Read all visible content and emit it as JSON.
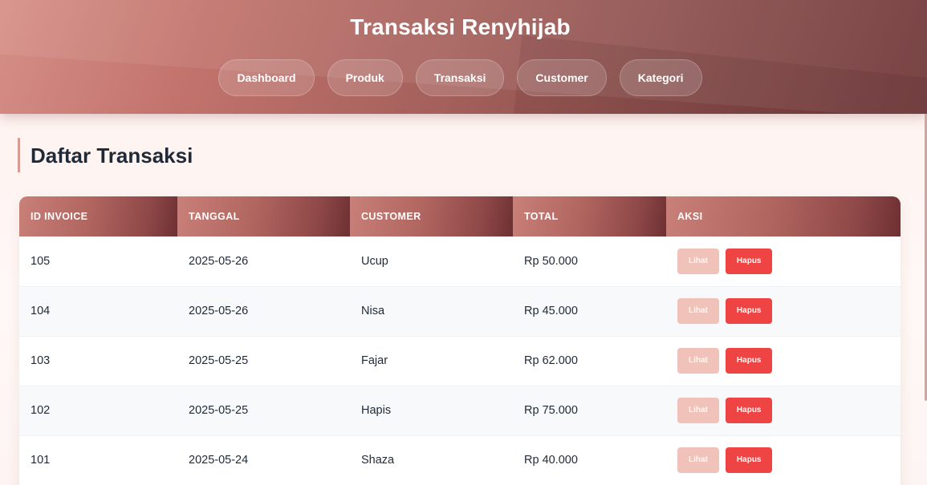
{
  "header": {
    "title": "Transaksi Renyhijab",
    "nav": [
      "Dashboard",
      "Produk",
      "Transaksi",
      "Customer",
      "Kategori"
    ]
  },
  "main": {
    "heading": "Daftar Transaksi",
    "table": {
      "columns": [
        "ID INVOICE",
        "TANGGAL",
        "CUSTOMER",
        "TOTAL",
        "AKSI"
      ],
      "rows": [
        {
          "id": "105",
          "tanggal": "2025-05-26",
          "customer": "Ucup",
          "total": "Rp 50.000"
        },
        {
          "id": "104",
          "tanggal": "2025-05-26",
          "customer": "Nisa",
          "total": "Rp 45.000"
        },
        {
          "id": "103",
          "tanggal": "2025-05-25",
          "customer": "Fajar",
          "total": "Rp 62.000"
        },
        {
          "id": "102",
          "tanggal": "2025-05-25",
          "customer": "Hapis",
          "total": "Rp 75.000"
        },
        {
          "id": "101",
          "tanggal": "2025-05-24",
          "customer": "Shaza",
          "total": "Rp 40.000"
        }
      ],
      "actions": {
        "view_label": "Lihat",
        "delete_label": "Hapus"
      }
    }
  },
  "colors": {
    "header_start": "#d58f87",
    "header_end": "#6f3537",
    "delete_button": "#ef4444",
    "view_button": "#f0c2b9"
  }
}
